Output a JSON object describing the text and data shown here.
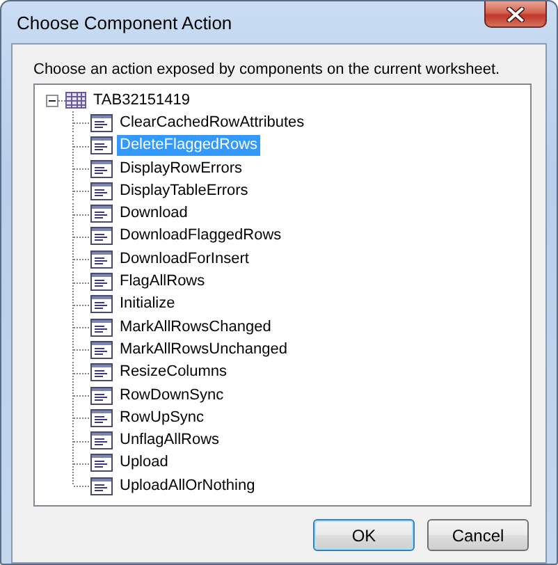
{
  "window": {
    "title": "Choose Component Action"
  },
  "instruction": "Choose an action exposed by components on the current worksheet.",
  "tree": {
    "label": "TAB32151419",
    "expanded": true,
    "selected": false,
    "children": [
      {
        "label": "ClearCachedRowAttributes",
        "selected": false
      },
      {
        "label": "DeleteFlaggedRows",
        "selected": true
      },
      {
        "label": "DisplayRowErrors",
        "selected": false
      },
      {
        "label": "DisplayTableErrors",
        "selected": false
      },
      {
        "label": "Download",
        "selected": false
      },
      {
        "label": "DownloadFlaggedRows",
        "selected": false
      },
      {
        "label": "DownloadForInsert",
        "selected": false
      },
      {
        "label": "FlagAllRows",
        "selected": false
      },
      {
        "label": "Initialize",
        "selected": false
      },
      {
        "label": "MarkAllRowsChanged",
        "selected": false
      },
      {
        "label": "MarkAllRowsUnchanged",
        "selected": false
      },
      {
        "label": "ResizeColumns",
        "selected": false
      },
      {
        "label": "RowDownSync",
        "selected": false
      },
      {
        "label": "RowUpSync",
        "selected": false
      },
      {
        "label": "UnflagAllRows",
        "selected": false
      },
      {
        "label": "Upload",
        "selected": false
      },
      {
        "label": "UploadAllOrNothing",
        "selected": false
      }
    ]
  },
  "buttons": [
    {
      "label": "OK",
      "default": true
    },
    {
      "label": "Cancel",
      "default": false
    }
  ]
}
